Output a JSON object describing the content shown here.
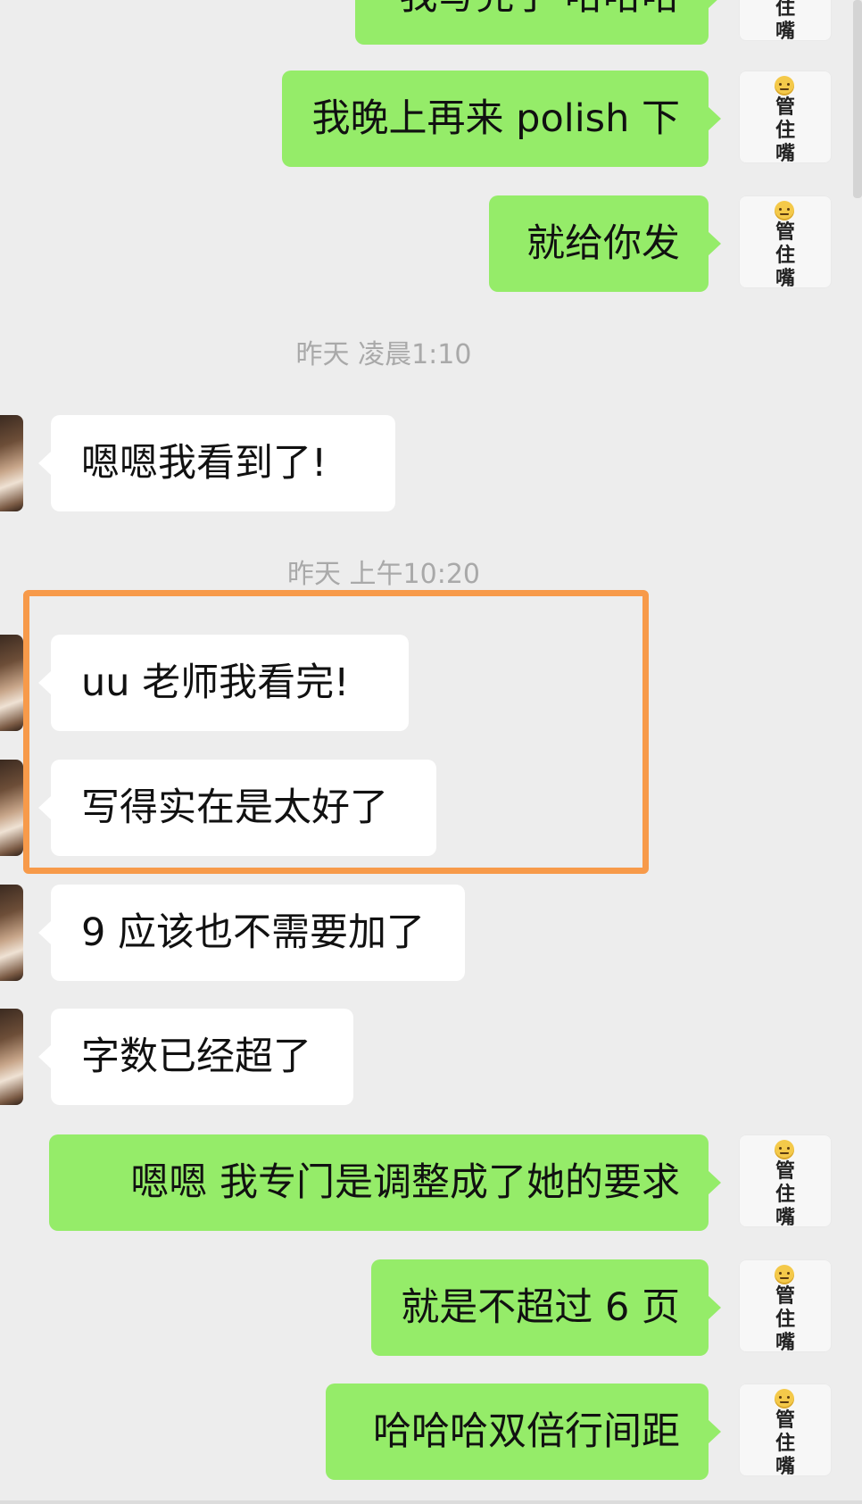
{
  "colors": {
    "background": "#ededed",
    "my_bubble": "#95ec69",
    "their_bubble": "#ffffff",
    "timestamp_text": "#a9a9a9",
    "highlight_border": "#f79a4a"
  },
  "my_avatar": {
    "emoji_icon": "zipper-mouth-face-icon",
    "text": "管\n住\n嘴"
  },
  "messages": [
    {
      "sender": "me",
      "text": "我写完了 哈哈哈"
    },
    {
      "sender": "me",
      "text": "我晚上再来 polish 下"
    },
    {
      "sender": "me",
      "text": "就给你发"
    },
    {
      "type": "timestamp",
      "text": "昨天 凌晨1:10"
    },
    {
      "sender": "them",
      "text": "嗯嗯我看到了!"
    },
    {
      "type": "timestamp",
      "text": "昨天 上午10:20"
    },
    {
      "sender": "them",
      "text": "uu 老师我看完!"
    },
    {
      "sender": "them",
      "text": "写得实在是太好了"
    },
    {
      "sender": "them",
      "text": "9 应该也不需要加了"
    },
    {
      "sender": "them",
      "text": "字数已经超了"
    },
    {
      "sender": "me",
      "text": "嗯嗯 我专门是调整成了她的要求"
    },
    {
      "sender": "me",
      "text": "就是不超过 6 页"
    },
    {
      "sender": "me",
      "text": "哈哈哈双倍行间距"
    }
  ]
}
